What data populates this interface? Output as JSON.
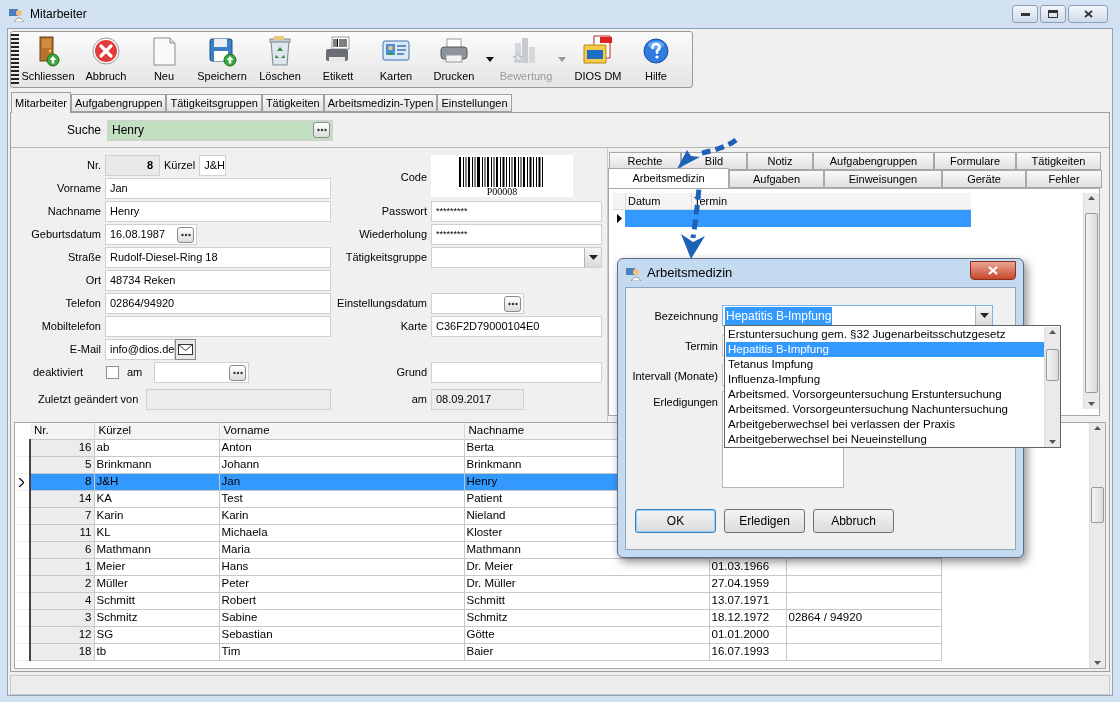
{
  "window": {
    "title": "Mitarbeiter"
  },
  "toolbar": [
    {
      "label": "Schliessen",
      "disabled": false,
      "menu": false
    },
    {
      "label": "Abbruch",
      "disabled": false,
      "menu": false
    },
    {
      "label": "Neu",
      "disabled": false,
      "menu": false
    },
    {
      "label": "Speichern",
      "disabled": false,
      "menu": false
    },
    {
      "label": "Löschen",
      "disabled": false,
      "menu": false
    },
    {
      "label": "Etikett",
      "disabled": false,
      "menu": false
    },
    {
      "label": "Karten",
      "disabled": false,
      "menu": false
    },
    {
      "label": "Drucken",
      "disabled": false,
      "menu": true
    },
    {
      "label": "Bewertung",
      "disabled": true,
      "menu": true
    },
    {
      "label": "DIOS DM",
      "disabled": false,
      "menu": false
    },
    {
      "label": "Hilfe",
      "disabled": false,
      "menu": false
    }
  ],
  "tabs": [
    {
      "label": "Mitarbeiter",
      "selected": true
    },
    {
      "label": "Aufgabengruppen",
      "selected": false
    },
    {
      "label": "Tätigkeitsgruppen",
      "selected": false
    },
    {
      "label": "Tätigkeiten",
      "selected": false
    },
    {
      "label": "Arbeitsmedizin-Typen",
      "selected": false
    },
    {
      "label": "Einstellungen",
      "selected": false
    }
  ],
  "search": {
    "label": "Suche",
    "value": "Henry"
  },
  "form": {
    "left": [
      {
        "kind": "nr",
        "label": "Nr.",
        "value": "8",
        "label2": "Kürzel",
        "value2": "J&H"
      },
      {
        "kind": "text",
        "label": "Vorname",
        "value": "Jan"
      },
      {
        "kind": "text",
        "label": "Nachname",
        "value": "Henry"
      },
      {
        "kind": "date",
        "label": "Geburtsdatum",
        "value": "16.08.1987"
      },
      {
        "kind": "text",
        "label": "Straße",
        "value": "Rudolf-Diesel-Ring 18"
      },
      {
        "kind": "text",
        "label": "Ort",
        "value": "48734 Reken"
      },
      {
        "kind": "text",
        "label": "Telefon",
        "value": "02864/94920"
      },
      {
        "kind": "text",
        "label": "Mobiltelefon"
      },
      {
        "kind": "email",
        "label": "E-Mail",
        "value": "info@dios.de"
      },
      {
        "kind": "check",
        "label": "deaktiviert",
        "checked": false,
        "label2": "am"
      },
      {
        "kind": "changed",
        "label": "Zuletzt geändert von"
      }
    ],
    "right": [
      {
        "kind": "barcode",
        "label": "Code",
        "value": "P00008"
      },
      {
        "kind": "password",
        "label": "Passwort",
        "value": "*********"
      },
      {
        "kind": "password",
        "label": "Wiederholung",
        "value": "*********"
      },
      {
        "kind": "combo",
        "label": "Tätigkeitsgruppe"
      },
      {
        "kind": "date",
        "label": "Einstellungsdatum"
      },
      {
        "kind": "text",
        "label": "Karte",
        "value": "C36F2D79000104E0"
      },
      {
        "kind": "text",
        "label": "Grund"
      },
      {
        "kind": "readonly",
        "label": "am",
        "value": "08.09.2017"
      }
    ]
  },
  "detail_tabs": {
    "back_row": [
      {
        "label": "Rechte",
        "selected": false
      },
      {
        "label": "Bild",
        "selected": false
      },
      {
        "label": "Notiz",
        "selected": false
      },
      {
        "label": "Aufgabengruppen",
        "selected": false
      },
      {
        "label": "Formulare",
        "selected": false
      },
      {
        "label": "Tätigkeiten",
        "selected": false
      }
    ],
    "front_row": [
      {
        "label": "Arbeitsmedizin",
        "selected": true
      },
      {
        "label": "Aufgaben",
        "selected": false
      },
      {
        "label": "Einweisungen",
        "selected": false
      },
      {
        "label": "Geräte",
        "selected": false
      },
      {
        "label": "Fehler",
        "selected": false
      }
    ]
  },
  "detail_grid": {
    "columns": [
      "Datum",
      "Termin"
    ],
    "rows": [
      {
        "selected": true
      }
    ]
  },
  "table": {
    "columns": [
      "Nr.",
      "Kürzel",
      "Vorname",
      "Nachname"
    ],
    "rows": [
      {
        "cells": [
          "16",
          "ab",
          "Anton",
          "Berta"
        ],
        "selected": false
      },
      {
        "cells": [
          "5",
          "Brinkmann",
          "Johann",
          "Brinkmann"
        ],
        "selected": false
      },
      {
        "cells": [
          "8",
          "J&H",
          "Jan",
          "Henry"
        ],
        "selected": true
      },
      {
        "cells": [
          "14",
          "KA",
          "Test",
          "Patient"
        ],
        "selected": false
      },
      {
        "cells": [
          "7",
          "Karin",
          "Karin",
          "Nieland"
        ],
        "selected": false
      },
      {
        "cells": [
          "11",
          "KL",
          "Michaela",
          "Kloster"
        ],
        "selected": false
      },
      {
        "cells": [
          "6",
          "Mathmann",
          "Maria",
          "Mathmann"
        ],
        "selected": false
      },
      {
        "cells": [
          "1",
          "Meier",
          "Hans",
          "Dr. Meier",
          "01.03.1966"
        ],
        "selected": false
      },
      {
        "cells": [
          "2",
          "Müller",
          "Peter",
          "Dr. Müller",
          "27.04.1959"
        ],
        "selected": false
      },
      {
        "cells": [
          "4",
          "Schmitt",
          "Robert",
          "Schmitt",
          "13.07.1971"
        ],
        "selected": false
      },
      {
        "cells": [
          "3",
          "Schmitz",
          "Sabine",
          "Schmitz",
          "18.12.1972",
          "02864 / 94920"
        ],
        "selected": false
      },
      {
        "cells": [
          "12",
          "SG",
          "Sebastian",
          "Götte",
          "01.01.2000"
        ],
        "selected": false
      },
      {
        "cells": [
          "18",
          "tb",
          "Tim",
          "Baier",
          "16.07.1993"
        ],
        "selected": false
      }
    ]
  },
  "dialog": {
    "title": "Arbeitsmedizin",
    "fields": [
      {
        "kind": "combo",
        "label": "Bezeichnung",
        "value": "Hepatitis B-Impfung"
      },
      {
        "kind": "text",
        "label": "Termin"
      },
      {
        "kind": "text",
        "label": "Intervall (Monate)"
      },
      {
        "kind": "list",
        "label": "Erledigungen"
      }
    ],
    "dropdown": [
      {
        "label": "Erstuntersuchung gem. §32 Jugenarbeitsschutzgesetz",
        "selected": false
      },
      {
        "label": "Hepatitis B-Impfung",
        "selected": true
      },
      {
        "label": "Tetanus Impfung",
        "selected": false
      },
      {
        "label": "Influenza-Impfung",
        "selected": false
      },
      {
        "label": "Arbeitsmed. Vorsorgeuntersuchung Erstuntersuchung",
        "selected": false
      },
      {
        "label": "Arbeitsmed. Vorsorgeuntersuchung Nachuntersuchung",
        "selected": false
      },
      {
        "label": "Arbeitgeberwechsel bei verlassen der Praxis",
        "selected": false
      },
      {
        "label": "Arbeitgeberwechsel bei Neueinstellung",
        "selected": false
      }
    ],
    "buttons": [
      {
        "label": "OK",
        "default": true
      },
      {
        "label": "Erledigen",
        "default": false
      },
      {
        "label": "Abbruch",
        "default": false
      }
    ]
  }
}
